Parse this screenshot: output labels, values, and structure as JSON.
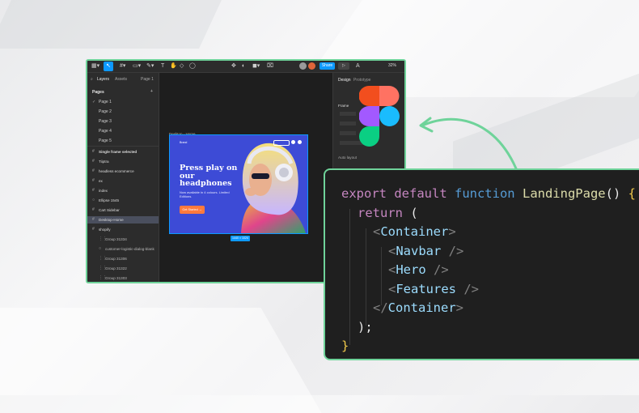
{
  "figma": {
    "toolbar": {
      "share_label": "Share",
      "play_label": "▷",
      "zoom_label": "32%"
    },
    "left_panel": {
      "tabs": [
        "Layers",
        "Assets",
        "Page 1"
      ],
      "pages_header": "Pages",
      "add_icon": "+",
      "pages": [
        "Page 1",
        "Page 2",
        "Page 3",
        "Page 4",
        "Page 5"
      ],
      "layers": [
        {
          "label": "Single frame selected",
          "icon": "#"
        },
        {
          "label": "Tiiptra",
          "icon": "#"
        },
        {
          "label": "headless ecommerce",
          "icon": "#"
        },
        {
          "label": "ex",
          "icon": "#"
        },
        {
          "label": "index",
          "icon": "#"
        },
        {
          "label": "Ellipse 1545",
          "icon": "○"
        },
        {
          "label": "Cart Sidebar",
          "icon": "#"
        },
        {
          "label": "Desktop-Home",
          "icon": "#"
        },
        {
          "label": "shopify",
          "icon": "#"
        },
        {
          "label": "Group 31334",
          "icon": "⋮⋮"
        },
        {
          "label": "customer-logistic-dialog-blank",
          "icon": "○"
        },
        {
          "label": "Group 31306",
          "icon": "⋮⋮"
        },
        {
          "label": "Group 31322",
          "icon": "⋮⋮"
        },
        {
          "label": "Group 31303",
          "icon": "⋮⋮"
        }
      ]
    },
    "right_panel": {
      "tabs": [
        "Design",
        "Prototype"
      ],
      "labels": [
        "Frame",
        "Auto layout"
      ]
    },
    "canvas": {
      "frame_label": "Desktop - Home",
      "size_badge": "1440 × 1024",
      "hero": {
        "nav": "Brand",
        "title": "Press play on our headphones",
        "subtitle": "Now available in 4 colours. Limited Editions.",
        "button": "Get Started →"
      }
    }
  },
  "code": {
    "lines": [
      "export default function LandingPage() {",
      "return (",
      "<Container>",
      "<Navbar />",
      "<Hero />",
      "<Features />",
      "</Container>",
      ");",
      "}"
    ]
  },
  "colors": {
    "accent_green": "#6fd39a",
    "figma_blue": "#0d99ff",
    "hero_blue": "#3d4bd6",
    "hero_orange": "#ff7a3d"
  }
}
